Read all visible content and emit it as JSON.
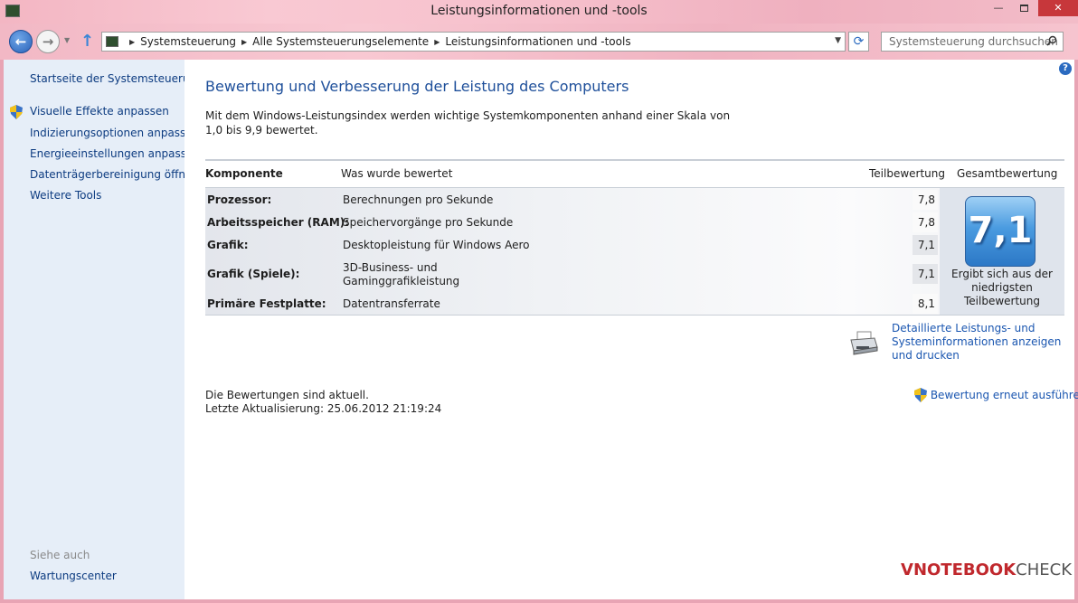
{
  "window": {
    "title": "Leistungsinformationen und -tools"
  },
  "controls": {
    "minimize": "—",
    "close": "✕"
  },
  "nav": {
    "back_icon": "←",
    "forward_icon": "→",
    "up_icon": "↑",
    "breadcrumbs": [
      "Systemsteuerung",
      "Alle Systemsteuerungselemente",
      "Leistungsinformationen und -tools"
    ],
    "search_placeholder": "Systemsteuerung durchsuchen"
  },
  "sidebar": {
    "home": "Startseite der Systemsteuerung",
    "items": [
      "Visuelle Effekte anpassen",
      "Indizierungsoptionen anpassen",
      "Energieeinstellungen anpassen",
      "Datenträgerbereinigung öffnen",
      "Weitere Tools"
    ],
    "see_also": "Siehe auch",
    "see_also_items": [
      "Wartungscenter"
    ]
  },
  "main": {
    "heading": "Bewertung und Verbesserung der Leistung des Computers",
    "intro": "Mit dem Windows-Leistungsindex werden wichtige Systemkomponenten anhand einer Skala von 1,0 bis 9,9 bewertet.",
    "columns": {
      "component": "Komponente",
      "what": "Was wurde bewertet",
      "subscore": "Teilbewertung",
      "basescore": "Gesamtbewertung"
    },
    "rows": [
      {
        "label": "Prozessor:",
        "what": "Berechnungen pro Sekunde",
        "score": "7,8"
      },
      {
        "label": "Arbeitsspeicher (RAM):",
        "what": "Speichervorgänge pro Sekunde",
        "score": "7,8"
      },
      {
        "label": "Grafik:",
        "what": "Desktopleistung für Windows Aero",
        "score": "7,1"
      },
      {
        "label": "Grafik (Spiele):",
        "what": "3D-Business- und Gaminggrafikleistung",
        "score": "7,1"
      },
      {
        "label": "Primäre Festplatte:",
        "what": "Datentransferrate",
        "score": "8,1"
      }
    ],
    "base_score": "7,1",
    "base_caption": "Ergibt sich aus der niedrigsten Teilbewertung",
    "detail_link": "Detaillierte Leistungs- und Systeminformationen anzeigen und drucken",
    "status": "Die Bewertungen sind aktuell.",
    "last_update": "Letzte Aktualisierung: 25.06.2012 21:19:24",
    "rerun": "Bewertung erneut ausführen",
    "help_icon": "?"
  },
  "watermark": {
    "v": "V",
    "notebook": "NOTEBOOK",
    "check": "CHECK"
  },
  "colors": {
    "link": "#1a56b0",
    "heading": "#1e4f9a",
    "sidebar_bg": "#e6eef8",
    "close_red": "#c7373b",
    "badge_blue": "#2c78c6"
  }
}
